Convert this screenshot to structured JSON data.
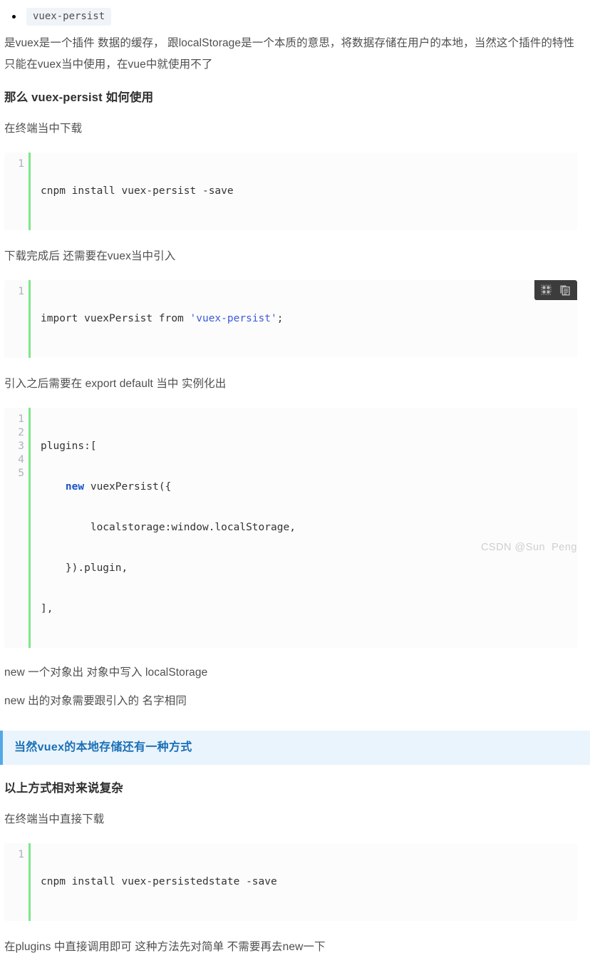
{
  "article": {
    "bullet_items": [
      {
        "code": "vuex-persist"
      }
    ],
    "paragraph_1_line_1": "是vuex是一个插件 数据的缓存， 跟localStorage是一个本质的意思，将数据存储在用户的本地，当然这个插件的特性",
    "paragraph_1_line_2": "只能在vuex当中使用，在vue中就使用不了",
    "heading_1": "那么 vuex-persist 如何使用",
    "paragraph_2": "在终端当中下载",
    "code_block_1": {
      "lines": [
        "1"
      ],
      "code": "cnpm install vuex-persist -save"
    },
    "paragraph_3": "下载完成后 还需要在vuex当中引入",
    "code_block_2": {
      "lines": [
        "1"
      ],
      "code_prefix": "import vuexPersist from ",
      "code_string": "'vuex-persist'",
      "code_suffix": ";",
      "toolbar": {
        "select_icon": "dotted-grid-icon",
        "copy_icon": "copy-icon"
      }
    },
    "paragraph_4": "引入之后需要在 export default 当中 实例化出",
    "code_block_3": {
      "lines": [
        "1",
        "2",
        "3",
        "4",
        "5"
      ],
      "line_1": "plugins:[",
      "line_2_indent": "    ",
      "line_2_kw": "new",
      "line_2_rest": " vuexPersist({",
      "line_3": "        localstorage:window.localStorage,",
      "line_4": "    }).plugin,",
      "line_5": "],"
    },
    "paragraph_5": "new 一个对象出 对象中写入 localStorage",
    "paragraph_6": "new 出的对象需要跟引入的 名字相同",
    "callout": "当然vuex的本地存储还有一种方式",
    "heading_2": "以上方式相对来说复杂",
    "paragraph_7": "在终端当中直接下载",
    "code_block_4": {
      "lines": [
        "1"
      ],
      "code": "cnpm install vuex-persistedstate -save"
    },
    "paragraph_8": "在plugins 中直接调用即可 这种方法先对简单 不需要再去new一下"
  },
  "watermark": "CSDN @Sun  Peng",
  "colors": {
    "accent_green": "#7ee787",
    "callout_border": "#54a8e8",
    "callout_bg": "#eaf4fd",
    "callout_text": "#1a6fb5",
    "code_bg": "#fcfcfc",
    "string_token": "#3b5bdb",
    "keyword_token": "#1a56c4",
    "toolbar_bg": "#3c3c3c",
    "watermark": "#cfcfcf"
  }
}
